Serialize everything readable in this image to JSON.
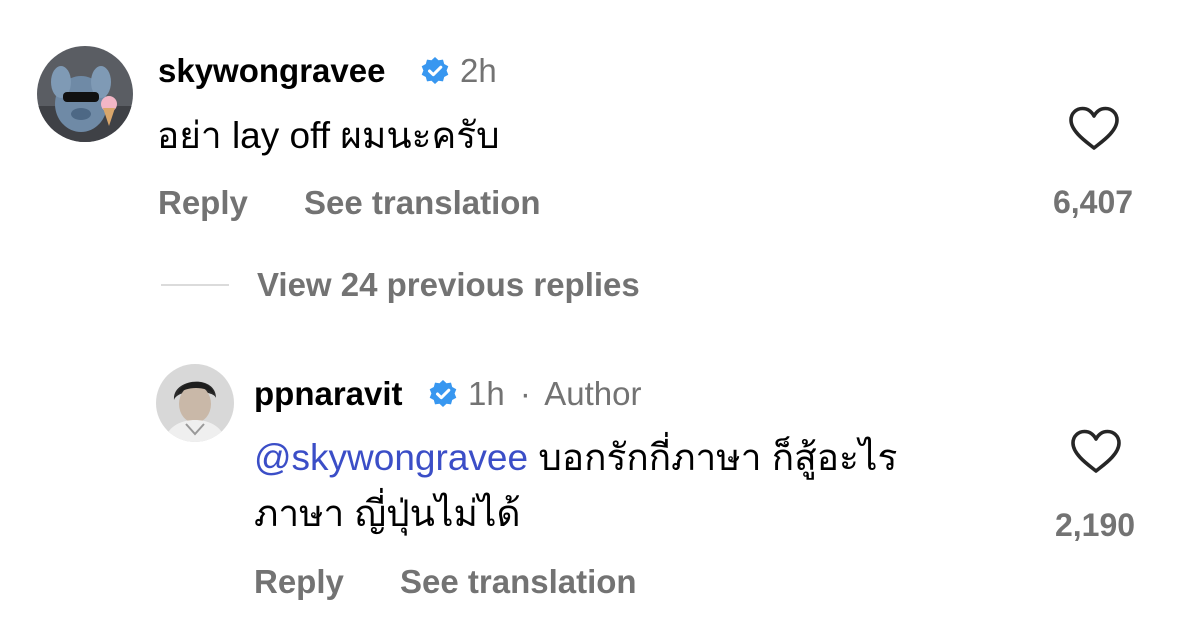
{
  "comments": [
    {
      "username": "skywongravee",
      "verified": true,
      "time": "2h",
      "text": "อย่า lay off ผมนะครับ",
      "reply_label": "Reply",
      "translate_label": "See translation",
      "like_count": "6,407"
    }
  ],
  "view_replies_label": "View 24 previous replies",
  "reply": {
    "username": "ppnaravit",
    "verified": true,
    "time": "1h",
    "separator": "·",
    "author_label": "Author",
    "mention": "@skywongravee",
    "text_line1": " บอกรักกี่ภาษา ก็สู้อะไร",
    "text_line2": "ภาษา ญี่ปุ่นไม่ได้",
    "reply_label": "Reply",
    "translate_label": "See translation",
    "like_count": "2,190"
  },
  "colors": {
    "verified": "#3897f0",
    "mention": "#3b4ec7",
    "secondary": "#737373"
  }
}
